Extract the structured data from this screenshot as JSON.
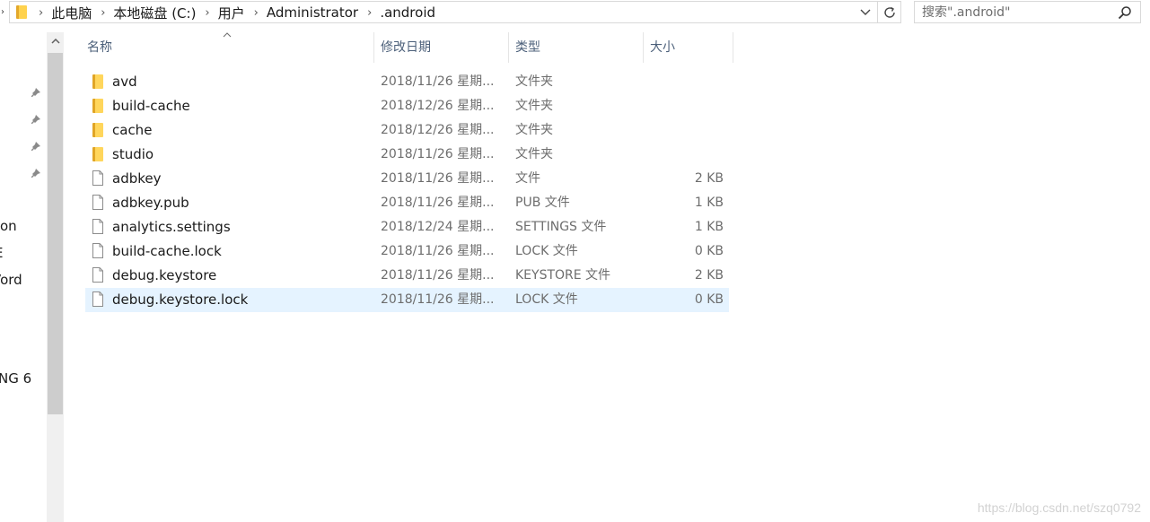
{
  "address_bar": {
    "crumbs": [
      "此电脑",
      "本地磁盘 (C:)",
      "用户",
      "Administrator",
      ".android"
    ]
  },
  "search": {
    "placeholder": "搜索\".android\""
  },
  "nav_fragments": [
    "on",
    "E",
    "Vord",
    "NG 6"
  ],
  "columns": {
    "name": "名称",
    "date": "修改日期",
    "type": "类型",
    "size": "大小"
  },
  "files": [
    {
      "icon": "folder-icon",
      "name": "avd",
      "date": "2018/11/26 星期...",
      "type": "文件夹",
      "size": ""
    },
    {
      "icon": "folder-icon",
      "name": "build-cache",
      "date": "2018/12/26 星期...",
      "type": "文件夹",
      "size": ""
    },
    {
      "icon": "folder-icon",
      "name": "cache",
      "date": "2018/12/26 星期...",
      "type": "文件夹",
      "size": ""
    },
    {
      "icon": "folder-icon",
      "name": "studio",
      "date": "2018/11/26 星期...",
      "type": "文件夹",
      "size": ""
    },
    {
      "icon": "file-icon",
      "name": "adbkey",
      "date": "2018/11/26 星期...",
      "type": "文件",
      "size": "2 KB"
    },
    {
      "icon": "file-icon",
      "name": "adbkey.pub",
      "date": "2018/11/26 星期...",
      "type": "PUB 文件",
      "size": "1 KB"
    },
    {
      "icon": "file-icon",
      "name": "analytics.settings",
      "date": "2018/12/24 星期...",
      "type": "SETTINGS 文件",
      "size": "1 KB"
    },
    {
      "icon": "file-icon",
      "name": "build-cache.lock",
      "date": "2018/11/26 星期...",
      "type": "LOCK 文件",
      "size": "0 KB"
    },
    {
      "icon": "file-icon",
      "name": "debug.keystore",
      "date": "2018/11/26 星期...",
      "type": "KEYSTORE 文件",
      "size": "2 KB"
    },
    {
      "icon": "file-icon",
      "name": "debug.keystore.lock",
      "date": "2018/11/26 星期...",
      "type": "LOCK 文件",
      "size": "0 KB",
      "selected": true
    }
  ],
  "watermark": "https://blog.csdn.net/szq0792",
  "colors": {
    "selection": "#e5f3ff",
    "header_text": "#4c607a",
    "folder": "#ffd65c"
  }
}
